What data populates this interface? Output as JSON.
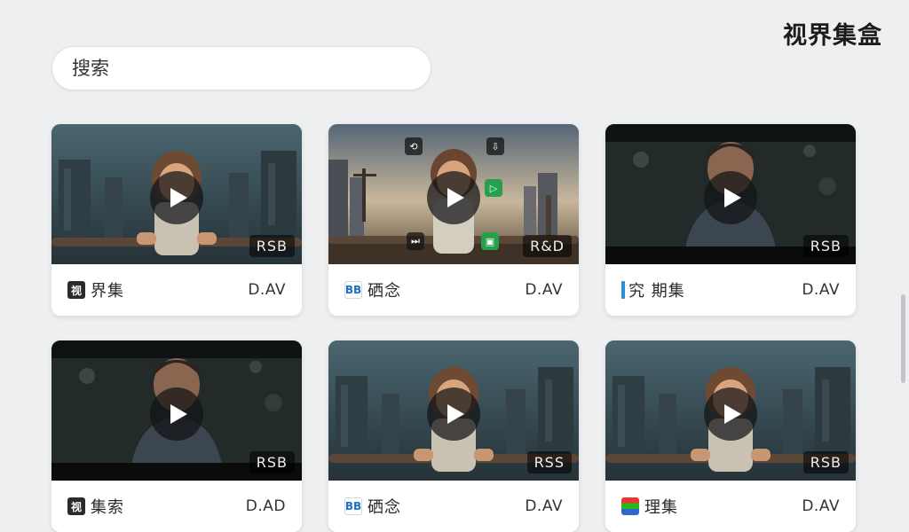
{
  "app_title": "视界集盒",
  "search": {
    "placeholder": "搜索"
  },
  "cards": [
    {
      "title": "界集",
      "label": "D.AV",
      "badge": "RSB",
      "scene": "girl",
      "icon": "dark",
      "icon_glyph": "视"
    },
    {
      "title": "硒念",
      "label": "D.AV",
      "badge": "R&D",
      "scene": "city",
      "icon": "blue",
      "icon_glyph": "BB"
    },
    {
      "title": "究 期集",
      "label": "D.AV",
      "badge": "RSB",
      "scene": "man",
      "icon": "bar",
      "icon_glyph": ""
    },
    {
      "title": "集索",
      "label": "D.AD",
      "badge": "RSB",
      "scene": "man",
      "icon": "dark",
      "icon_glyph": "视"
    },
    {
      "title": "硒念",
      "label": "D.AV",
      "badge": "RSS",
      "scene": "girl",
      "icon": "blue",
      "icon_glyph": "BB"
    },
    {
      "title": "理集",
      "label": "D.AV",
      "badge": "RSB",
      "scene": "girl",
      "icon": "multi",
      "icon_glyph": ""
    }
  ]
}
